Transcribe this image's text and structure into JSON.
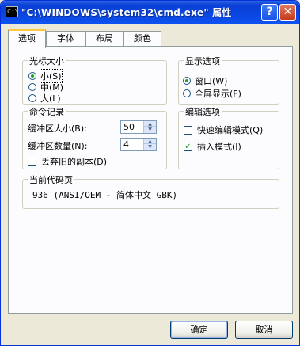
{
  "window": {
    "title": "\"C:\\WINDOWS\\system32\\cmd.exe\" 属性",
    "icon_text": "C:\\",
    "help_label": "?",
    "close_label": "✕"
  },
  "tabs": [
    "选项",
    "字体",
    "布局",
    "颜色"
  ],
  "active_tab": "选项",
  "cursor_size": {
    "title": "光标大小",
    "options": [
      "小(S)",
      "中(M)",
      "大(L)"
    ],
    "selected": "小(S)"
  },
  "display_options": {
    "title": "显示选项",
    "options": [
      "窗口(W)",
      "全屏显示(F)"
    ],
    "selected": "窗口(W)"
  },
  "command_history": {
    "title": "命令记录",
    "buffer_size_label": "缓冲区大小(B):",
    "buffer_size_value": "50",
    "buffer_count_label": "缓冲区数量(N):",
    "buffer_count_value": "4",
    "discard_label": "丢弃旧的副本(D)",
    "discard_checked": false
  },
  "edit_options": {
    "title": "编辑选项",
    "quick_edit_label": "快速编辑模式(Q)",
    "quick_edit_checked": false,
    "insert_mode_label": "插入模式(I)",
    "insert_mode_checked": true
  },
  "code_page": {
    "title": "当前代码页",
    "value": "936    (ANSI/OEM - 简体中文 GBK)"
  },
  "buttons": {
    "ok": "确定",
    "cancel": "取消"
  },
  "check_mark": "✓",
  "colors": {
    "titlebar": "#0A46E0",
    "face": "#ECE9D8",
    "tab_highlight": "#FFC83C",
    "radio_dot": "#21A121"
  }
}
